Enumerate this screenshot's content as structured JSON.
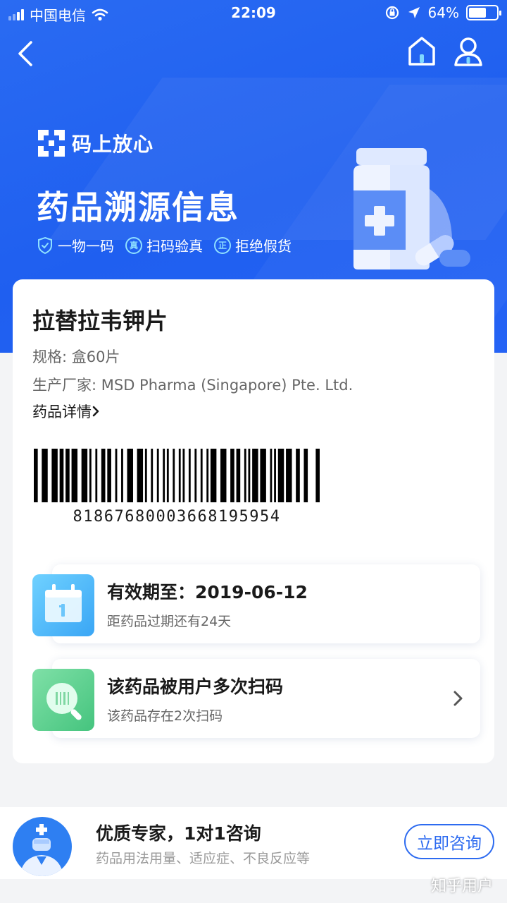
{
  "status_bar": {
    "carrier": "中国电信",
    "time": "22:09",
    "battery": "64%",
    "battery_level": 0.64
  },
  "hero": {
    "brand": "码上放心",
    "title": "药品溯源信息",
    "tags": [
      {
        "icon": "shield-check-icon",
        "label": "一物一码"
      },
      {
        "icon": "zhen-badge-icon",
        "badge": "真",
        "label": "扫码验真"
      },
      {
        "icon": "zheng-badge-icon",
        "badge": "正",
        "label": "拒绝假货"
      }
    ]
  },
  "product": {
    "name": "拉替拉韦钾片",
    "spec": "规格: 盒60片",
    "manufacturer": "生产厂家: MSD Pharma (Singapore) Pte. Ltd.",
    "detail_link": "药品详情",
    "barcode_number": "81867680003668195954"
  },
  "expiry": {
    "title": "有效期至：2019-06-12",
    "subtitle": "距药品过期还有24天",
    "icon": "calendar-icon"
  },
  "scans": {
    "title": "该药品被用户多次扫码",
    "subtitle": "该药品存在2次扫码",
    "icon": "magnifier-scan-icon"
  },
  "consult": {
    "title": "优质专家，1对1咨询",
    "subtitle": "药品用法用量、适应症、不良反应等",
    "button": "立即咨询"
  },
  "watermark": "知乎用户",
  "colors": {
    "primary_blue": "#1f5ff0",
    "expiry_icon": "#3aa6f5",
    "scan_icon": "#45c47e",
    "button_blue": "#2d6bf0"
  }
}
